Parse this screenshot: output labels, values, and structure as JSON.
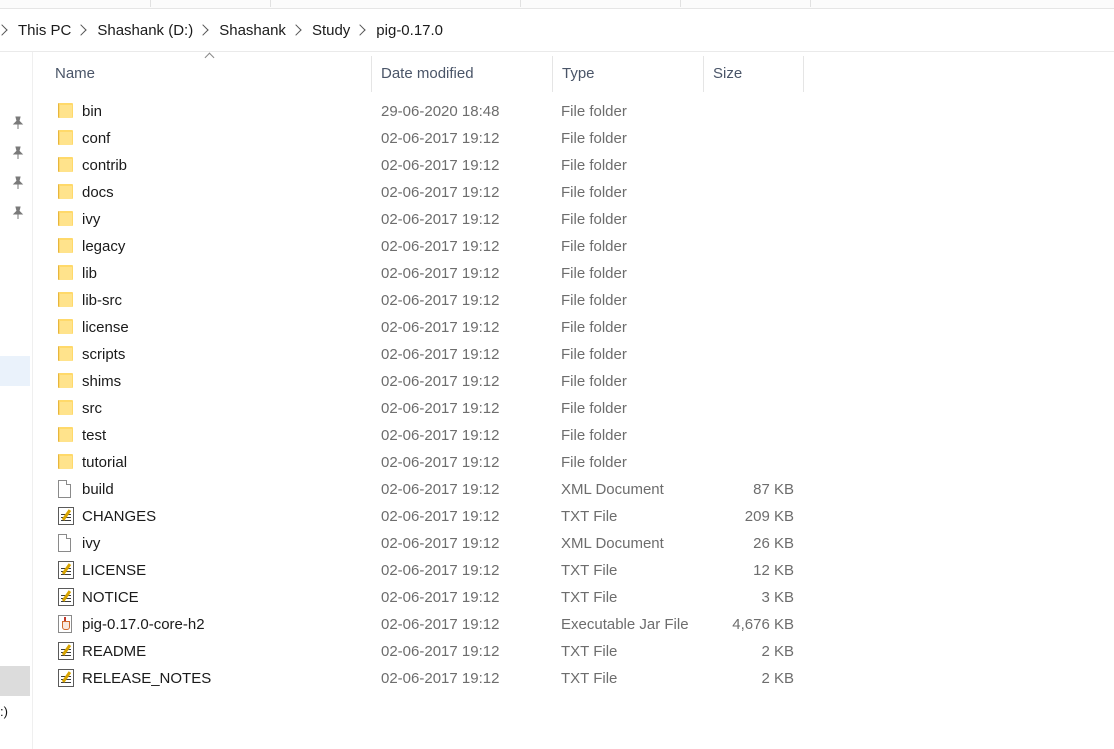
{
  "breadcrumb": [
    "This PC",
    "Shashank (D:)",
    "Shashank",
    "Study",
    "pig-0.17.0"
  ],
  "columns": {
    "name": "Name",
    "date": "Date modified",
    "type": "Type",
    "size": "Size"
  },
  "nav_fragment": ":)",
  "files": [
    {
      "name": "bin",
      "date": "29-06-2020 18:48",
      "type": "File folder",
      "size": "",
      "icon": "folder-icon"
    },
    {
      "name": "conf",
      "date": "02-06-2017 19:12",
      "type": "File folder",
      "size": "",
      "icon": "folder-icon"
    },
    {
      "name": "contrib",
      "date": "02-06-2017 19:12",
      "type": "File folder",
      "size": "",
      "icon": "folder-icon"
    },
    {
      "name": "docs",
      "date": "02-06-2017 19:12",
      "type": "File folder",
      "size": "",
      "icon": "folder-icon"
    },
    {
      "name": "ivy",
      "date": "02-06-2017 19:12",
      "type": "File folder",
      "size": "",
      "icon": "folder-icon"
    },
    {
      "name": "legacy",
      "date": "02-06-2017 19:12",
      "type": "File folder",
      "size": "",
      "icon": "folder-icon"
    },
    {
      "name": "lib",
      "date": "02-06-2017 19:12",
      "type": "File folder",
      "size": "",
      "icon": "folder-icon"
    },
    {
      "name": "lib-src",
      "date": "02-06-2017 19:12",
      "type": "File folder",
      "size": "",
      "icon": "folder-icon"
    },
    {
      "name": "license",
      "date": "02-06-2017 19:12",
      "type": "File folder",
      "size": "",
      "icon": "folder-icon"
    },
    {
      "name": "scripts",
      "date": "02-06-2017 19:12",
      "type": "File folder",
      "size": "",
      "icon": "folder-icon"
    },
    {
      "name": "shims",
      "date": "02-06-2017 19:12",
      "type": "File folder",
      "size": "",
      "icon": "folder-icon"
    },
    {
      "name": "src",
      "date": "02-06-2017 19:12",
      "type": "File folder",
      "size": "",
      "icon": "folder-icon"
    },
    {
      "name": "test",
      "date": "02-06-2017 19:12",
      "type": "File folder",
      "size": "",
      "icon": "folder-icon"
    },
    {
      "name": "tutorial",
      "date": "02-06-2017 19:12",
      "type": "File folder",
      "size": "",
      "icon": "folder-icon"
    },
    {
      "name": "build",
      "date": "02-06-2017 19:12",
      "type": "XML Document",
      "size": "87 KB",
      "icon": "xml-document-icon"
    },
    {
      "name": "CHANGES",
      "date": "02-06-2017 19:12",
      "type": "TXT File",
      "size": "209 KB",
      "icon": "text-file-icon"
    },
    {
      "name": "ivy",
      "date": "02-06-2017 19:12",
      "type": "XML Document",
      "size": "26 KB",
      "icon": "xml-document-icon"
    },
    {
      "name": "LICENSE",
      "date": "02-06-2017 19:12",
      "type": "TXT File",
      "size": "12 KB",
      "icon": "text-file-icon"
    },
    {
      "name": "NOTICE",
      "date": "02-06-2017 19:12",
      "type": "TXT File",
      "size": "3 KB",
      "icon": "text-file-icon"
    },
    {
      "name": "pig-0.17.0-core-h2",
      "date": "02-06-2017 19:12",
      "type": "Executable Jar File",
      "size": "4,676 KB",
      "icon": "jar-file-icon"
    },
    {
      "name": "README",
      "date": "02-06-2017 19:12",
      "type": "TXT File",
      "size": "2 KB",
      "icon": "text-file-icon"
    },
    {
      "name": "RELEASE_NOTES",
      "date": "02-06-2017 19:12",
      "type": "TXT File",
      "size": "2 KB",
      "icon": "text-file-icon"
    }
  ]
}
